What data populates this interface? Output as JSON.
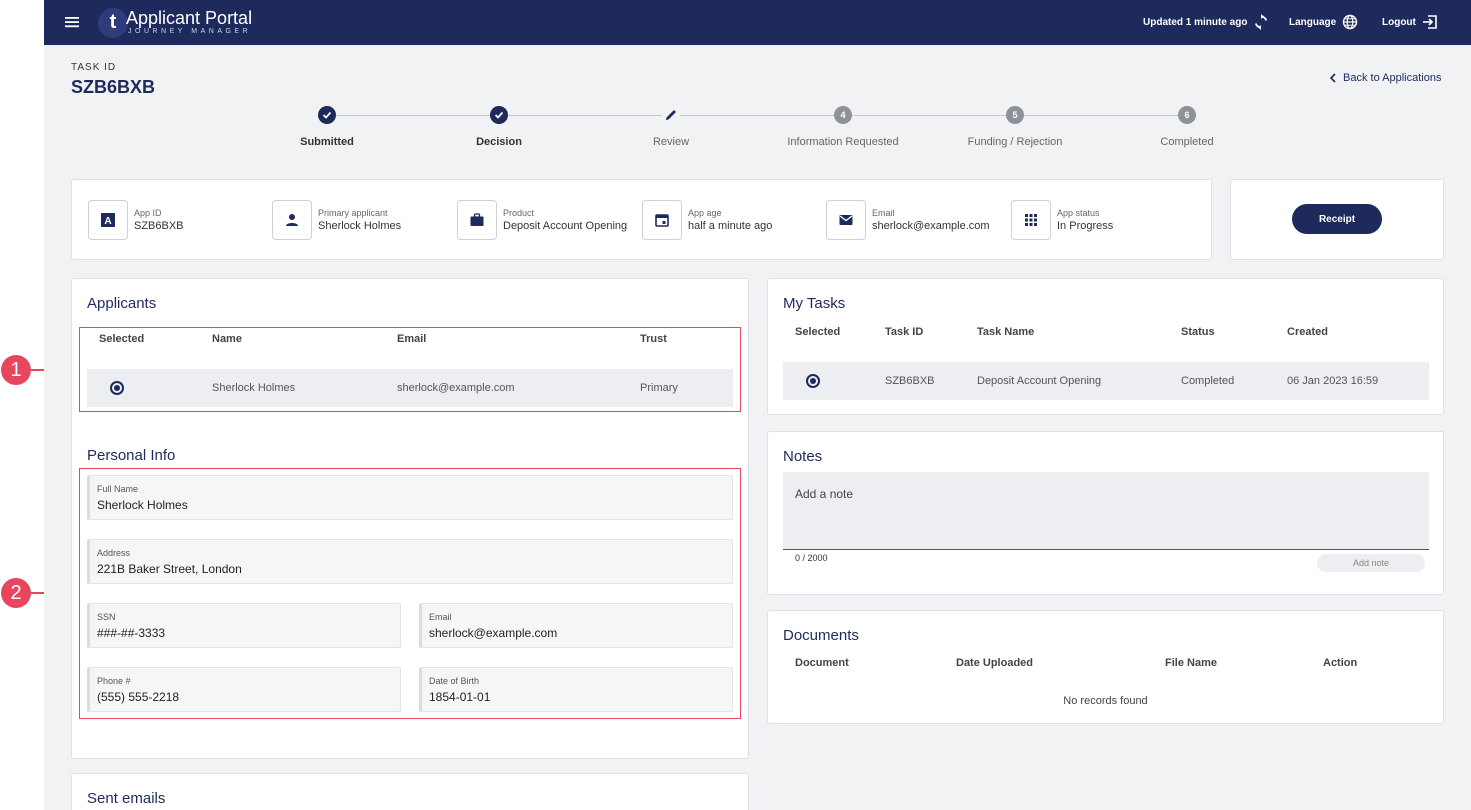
{
  "header": {
    "brand_title": "Applicant Portal",
    "brand_sub": "JOURNEY MANAGER",
    "logo_letter": "t",
    "updated": "Updated 1 minute ago",
    "language": "Language",
    "logout": "Logout"
  },
  "task": {
    "label": "TASK ID",
    "id": "SZB6BXB",
    "back": "Back to Applications"
  },
  "stepper": [
    {
      "label": "Submitted",
      "state": "done"
    },
    {
      "label": "Decision",
      "state": "done"
    },
    {
      "label": "Review",
      "state": "current"
    },
    {
      "label": "Information Requested",
      "state": "pending",
      "num": "4"
    },
    {
      "label": "Funding / Rejection",
      "state": "pending",
      "num": "5"
    },
    {
      "label": "Completed",
      "state": "pending",
      "num": "6"
    }
  ],
  "summary": [
    {
      "key": "App ID",
      "value": "SZB6BXB",
      "icon": "app-id-icon"
    },
    {
      "key": "Primary applicant",
      "value": "Sherlock Holmes",
      "icon": "person-icon"
    },
    {
      "key": "Product",
      "value": "Deposit Account Opening",
      "icon": "briefcase-icon"
    },
    {
      "key": "App age",
      "value": "half a minute ago",
      "icon": "calendar-icon"
    },
    {
      "key": "Email",
      "value": "sherlock@example.com",
      "icon": "mail-icon"
    },
    {
      "key": "App status",
      "value": "In Progress",
      "icon": "grid-icon"
    }
  ],
  "receipt_label": "Receipt",
  "applicants": {
    "title": "Applicants",
    "headers": [
      "Selected",
      "Name",
      "Email",
      "Trust"
    ],
    "row": {
      "name": "Sherlock Holmes",
      "email": "sherlock@example.com",
      "trust": "Primary"
    }
  },
  "personal": {
    "title": "Personal Info",
    "full_name_label": "Full Name",
    "full_name": "Sherlock Holmes",
    "address_label": "Address",
    "address": "221B Baker Street, London",
    "ssn_label": "SSN",
    "ssn": "###-##-3333",
    "email_label": "Email",
    "email": "sherlock@example.com",
    "phone_label": "Phone #",
    "phone": "(555) 555-2218",
    "dob_label": "Date of Birth",
    "dob": "1854-01-01"
  },
  "sent_emails_title": "Sent emails",
  "tasks": {
    "title": "My Tasks",
    "headers": [
      "Selected",
      "Task ID",
      "Task Name",
      "Status",
      "Created"
    ],
    "row": {
      "id": "SZB6BXB",
      "name": "Deposit Account Opening",
      "status": "Completed",
      "created": "06 Jan 2023 16:59"
    }
  },
  "notes": {
    "title": "Notes",
    "placeholder": "Add a note",
    "count": "0 / 2000",
    "button": "Add note"
  },
  "documents": {
    "title": "Documents",
    "headers": [
      "Document",
      "Date Uploaded",
      "File Name",
      "Action"
    ],
    "empty": "No records found"
  },
  "callouts": [
    "1",
    "2"
  ],
  "colors": {
    "navy": "#1e2a5c",
    "callout": "#e8465f",
    "background": "#f0f2f4"
  }
}
